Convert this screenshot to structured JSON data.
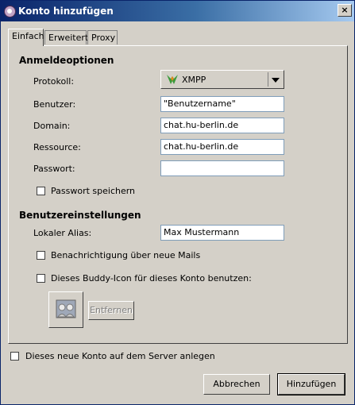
{
  "window": {
    "title": "Konto hinzufügen",
    "close": "×"
  },
  "tabs": [
    {
      "label": "Einfach",
      "active": true
    },
    {
      "label": "Erweitert",
      "active": false
    },
    {
      "label": "Proxy",
      "active": false
    }
  ],
  "login": {
    "heading": "Anmeldeoptionen",
    "protocol_label": "Protokoll:",
    "protocol_value": "XMPP",
    "user_label": "Benutzer:",
    "user_value": "\"Benutzername\"",
    "domain_label": "Domain:",
    "domain_value": "chat.hu-berlin.de",
    "resource_label": "Ressource:",
    "resource_value": "chat.hu-berlin.de",
    "password_label": "Passwort:",
    "password_value": "",
    "save_password_label": "Passwort speichern",
    "save_password_checked": false
  },
  "user_settings": {
    "heading": "Benutzereinstellungen",
    "alias_label": "Lokaler Alias:",
    "alias_value": "Max Mustermann",
    "notify_label": "Benachrichtigung über neue Mails",
    "notify_checked": false,
    "buddy_icon_label": "Dieses Buddy-Icon für dieses Konto benutzen:",
    "buddy_icon_checked": false,
    "remove_label": "Entfernen"
  },
  "register": {
    "label": "Dieses neue Konto auf dem Server anlegen",
    "checked": false
  },
  "buttons": {
    "cancel": "Abbrechen",
    "add": "Hinzufügen"
  }
}
